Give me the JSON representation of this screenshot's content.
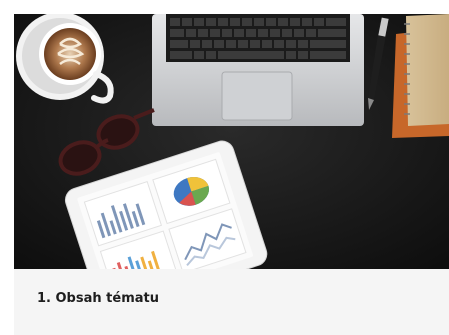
{
  "card": {
    "title": "1. Obsah tématu",
    "image_subject": "desk-with-laptop-coffee-tablet-notebook-photo"
  },
  "colors": {
    "card_background": "#f5f5f5",
    "title_text": "#1e1e1e",
    "desk": "#141414"
  }
}
